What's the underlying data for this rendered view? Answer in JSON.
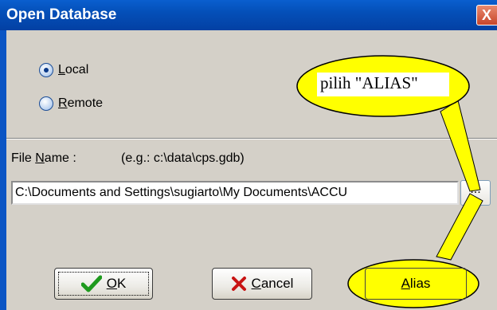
{
  "window": {
    "title": "Open Database",
    "close_symbol": "X"
  },
  "location": {
    "local": {
      "prefix": "",
      "mnemonic": "L",
      "rest": "ocal",
      "checked": true
    },
    "remote": {
      "mnemonic": "R",
      "rest": "emote",
      "checked": false
    }
  },
  "file": {
    "label_pre": "File ",
    "label_mnemonic": "N",
    "label_post": "ame :",
    "hint": "(e.g.: c:\\data\\cps.gdb)",
    "path_value": "C:\\Documents and Settings\\sugiarto\\My Documents\\ACCU",
    "browse_label": "..."
  },
  "buttons": {
    "ok": {
      "mnemonic": "O",
      "rest": "K"
    },
    "cancel": {
      "mnemonic": "C",
      "rest": "ancel"
    },
    "alias": {
      "mnemonic": "A",
      "rest": "lias"
    }
  },
  "annotation": {
    "text": "pilih \"ALIAS\"",
    "color": "#ffff00"
  },
  "icons": {
    "ok": "checkmark-icon",
    "cancel": "x-cross-icon"
  }
}
